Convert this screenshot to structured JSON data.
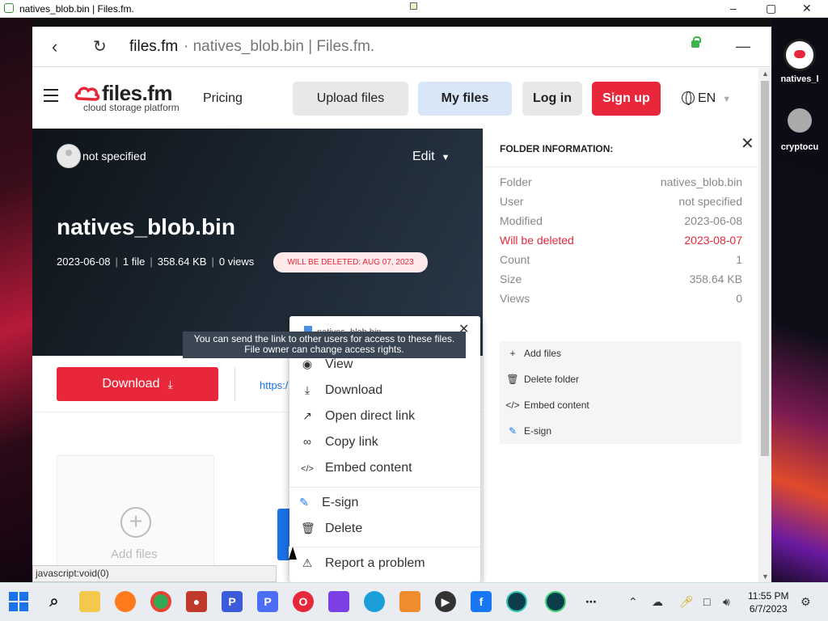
{
  "window": {
    "title": "natives_blob.bin | Files.fm.",
    "controls": {
      "minimize": "–",
      "maximize": "▢",
      "close": "✕"
    }
  },
  "browser": {
    "domain": "files.fm",
    "page_title": "· natives_blob.bin | Files.fm.",
    "status_bar": "javascript:void(0)"
  },
  "site": {
    "logo_text": "files.fm",
    "logo_sub": "cloud storage platform",
    "nav_pricing": "Pricing",
    "btn_upload": "Upload files",
    "btn_myfiles": "My files",
    "btn_login": "Log in",
    "btn_signup": "Sign up",
    "language": "EN"
  },
  "hero": {
    "owner": "not specified",
    "edit": "Edit",
    "file_name": "natives_blob.bin",
    "date": "2023-06-08",
    "file_count": "1 file",
    "size": "358.64 KB",
    "views": "0 views",
    "delete_badge": "WILL BE DELETED: AUG 07, 2023"
  },
  "actions_row": {
    "download_label": "Download",
    "link_preview": "https:/"
  },
  "add_card": {
    "label": "Add files"
  },
  "folder_info": {
    "header": "FOLDER INFORMATION:",
    "rows": [
      {
        "key": "Folder",
        "value": "natives_blob.bin"
      },
      {
        "key": "User",
        "value": "not specified"
      },
      {
        "key": "Modified",
        "value": "2023-06-08"
      },
      {
        "key": "Will be deleted",
        "value": "2023-08-07"
      },
      {
        "key": "Count",
        "value": "1"
      },
      {
        "key": "Size",
        "value": "358.64 KB"
      },
      {
        "key": "Views",
        "value": "0"
      }
    ],
    "actions": [
      {
        "label": "Add files",
        "icon": "plus-icon"
      },
      {
        "label": "Delete folder",
        "icon": "trash-icon"
      },
      {
        "label": "Embed content",
        "icon": "code-icon"
      },
      {
        "label": "E-sign",
        "icon": "esign-icon"
      }
    ]
  },
  "context_menu": {
    "file_name": "natives_blob.bin",
    "tooltip_line1": "You can send the link to other users for access to these files.",
    "tooltip_line2": "File owner can change access rights.",
    "items": [
      {
        "label": "View",
        "icon": "eye-icon"
      },
      {
        "label": "Download",
        "icon": "download-icon"
      },
      {
        "label": "Open direct link",
        "icon": "external-link-icon"
      },
      {
        "label": "Copy link",
        "icon": "link-icon"
      },
      {
        "label": "Embed content",
        "icon": "code-icon"
      },
      {
        "label": "E-sign",
        "icon": "esign-icon"
      },
      {
        "label": "Delete",
        "icon": "trash-icon"
      },
      {
        "label": "Report a problem",
        "icon": "warning-icon"
      }
    ]
  },
  "desktop_icons": [
    {
      "label": "natives_l"
    },
    {
      "label": "cryptocu"
    }
  ],
  "taskbar": {
    "time": "11:55 PM",
    "date": "6/7/2023"
  },
  "colors": {
    "brand_red": "#e8283a",
    "my_files_bg": "#d9e6f7",
    "tooltip_bg": "#3a4654"
  }
}
